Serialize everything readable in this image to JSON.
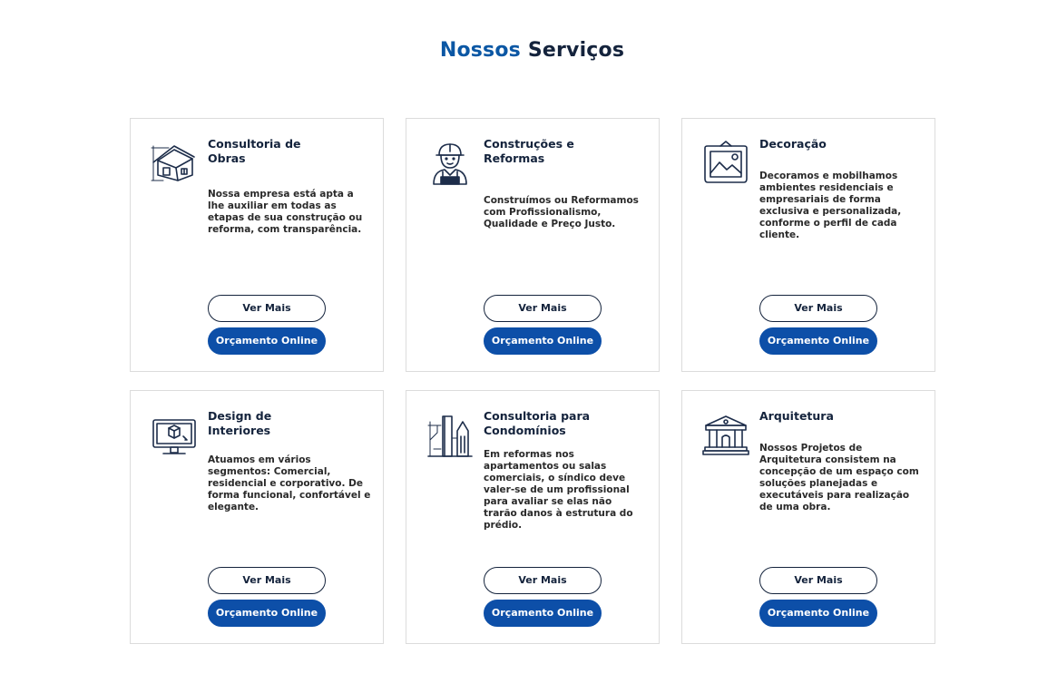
{
  "section": {
    "title_accent": "Nossos",
    "title_rest": "Serviços"
  },
  "buttons": {
    "more": "Ver Mais",
    "quote": "Orçamento Online"
  },
  "colors": {
    "accent": "#0b57a4",
    "dark": "#14233c",
    "button": "#0d4fa8"
  },
  "services": [
    {
      "icon": "house-blueprint-icon",
      "title": "Consultoria de\nObras",
      "description": "Nossa empresa está apta a lhe auxiliar em todas as etapas de sua construção ou reforma, com transparência."
    },
    {
      "icon": "construction-worker-icon",
      "title": "Construções e\nReformas",
      "description": "Construímos ou Reformamos com Profissionalismo, Qualidade e Preço Justo."
    },
    {
      "icon": "framed-picture-icon",
      "title": "Decoração",
      "description": "Decoramos e mobilhamos ambientes residenciais e empresariais de forma exclusiva e personalizada, conforme o perfil de cada cliente."
    },
    {
      "icon": "computer-monitor-icon",
      "title": "Design de\nInteriores",
      "description": "Atuamos em vários segmentos: Comercial, residencial e corporativo. De forma funcional, confortável e elegante."
    },
    {
      "icon": "buildings-crane-icon",
      "title": "Consultoria para\nCondomínios",
      "description": "Em reformas nos apartamentos ou salas comerciais, o síndico deve valer-se de um profissional para avaliar se elas não trarão danos à estrutura do prédio."
    },
    {
      "icon": "classical-building-icon",
      "title": "Arquitetura",
      "description": "Nossos Projetos de Arquitetura consistem na concepção de um espaço com soluções planejadas e executáveis para realização de uma obra."
    }
  ]
}
